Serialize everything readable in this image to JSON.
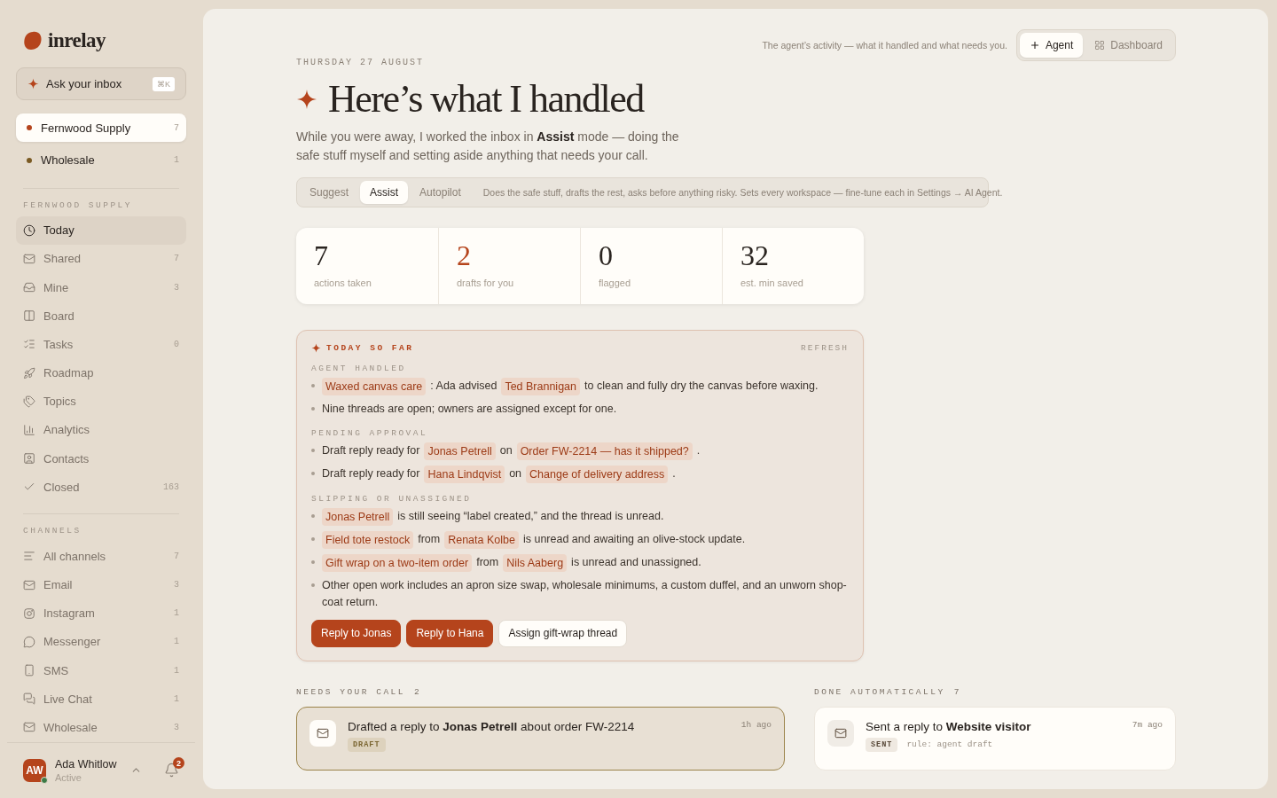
{
  "brand": {
    "name": "inrelay"
  },
  "ask": {
    "label": "Ask your inbox",
    "shortcut": "⌘K"
  },
  "workspaces": [
    {
      "name": "Fernwood Supply",
      "count": "7",
      "color": "#b5441c",
      "selected": true
    },
    {
      "name": "Wholesale",
      "count": "1",
      "color": "#7a5a22",
      "selected": false
    }
  ],
  "nav": {
    "title": "FERNWOOD SUPPLY",
    "items": [
      {
        "label": "Today",
        "selected": true
      },
      {
        "label": "Shared",
        "count": "7",
        "selected": false
      },
      {
        "label": "Mine",
        "count": "3",
        "selected": false
      },
      {
        "label": "Board",
        "selected": false
      },
      {
        "label": "Tasks",
        "count": "0",
        "selected": false
      },
      {
        "label": "Roadmap",
        "selected": false
      },
      {
        "label": "Topics",
        "selected": false
      },
      {
        "label": "Analytics",
        "selected": false
      },
      {
        "label": "Contacts",
        "selected": false
      },
      {
        "label": "Closed",
        "count": "163",
        "selected": false
      }
    ]
  },
  "channels": {
    "title": "CHANNELS",
    "items": [
      {
        "label": "All channels",
        "count": "7",
        "selected": false
      },
      {
        "label": "Email",
        "count": "3",
        "selected": false
      },
      {
        "label": "Instagram",
        "count": "1",
        "selected": false
      },
      {
        "label": "Messenger",
        "count": "1",
        "selected": false
      },
      {
        "label": "SMS",
        "count": "1",
        "selected": false
      },
      {
        "label": "Live Chat",
        "count": "1",
        "selected": false
      },
      {
        "label": "Wholesale",
        "count": "3",
        "selected": false
      }
    ]
  },
  "user": {
    "initials": "AW",
    "name": "Ada Whitlow",
    "status": "Active",
    "online": true,
    "notifications": "2"
  },
  "header": {
    "caption": "The agent’s activity — what it handled and what needs you.",
    "views": [
      {
        "label": "Agent",
        "selected": true
      },
      {
        "label": "Dashboard",
        "selected": false
      }
    ]
  },
  "date": "THURSDAY 27 AUGUST",
  "title": "Here’s what I handled",
  "intro": "While you were away, I worked the inbox in **Assist** mode — doing the safe stuff myself and setting aside anything that needs your call.",
  "modes": {
    "options": [
      {
        "label": "Suggest",
        "selected": false
      },
      {
        "label": "Assist",
        "selected": true
      },
      {
        "label": "Autopilot",
        "selected": false
      }
    ],
    "description": "Does the safe stuff, drafts the rest, asks before anything risky. Sets every workspace — fine-tune each in Settings → AI Agent."
  },
  "stats": [
    {
      "value": "7",
      "label": "actions taken",
      "highlight": false
    },
    {
      "value": "2",
      "label": "drafts for you",
      "highlight": true
    },
    {
      "value": "0",
      "label": "flagged",
      "highlight": false
    },
    {
      "value": "32",
      "label": "est. min saved",
      "highlight": false
    }
  ],
  "summary": {
    "title": "TODAY SO FAR",
    "refresh": "REFRESH",
    "sections": [
      {
        "heading": "AGENT HANDLED",
        "items": [
          [
            {
              "kind": "chip",
              "text": "Waxed canvas care"
            },
            {
              "kind": "text",
              "text": ": Ada advised"
            },
            {
              "kind": "chip",
              "text": "Ted Brannigan"
            },
            {
              "kind": "text",
              "text": "to clean and fully dry the canvas before waxing."
            }
          ],
          [
            {
              "kind": "text",
              "text": "Nine threads are open; owners are assigned except for one."
            }
          ]
        ]
      },
      {
        "heading": "PENDING APPROVAL",
        "items": [
          [
            {
              "kind": "text",
              "text": "Draft reply ready for"
            },
            {
              "kind": "chip",
              "text": "Jonas Petrell"
            },
            {
              "kind": "text",
              "text": "on"
            },
            {
              "kind": "chip",
              "text": "Order FW-2214 — has it shipped?"
            },
            {
              "kind": "text",
              "text": "."
            }
          ],
          [
            {
              "kind": "text",
              "text": "Draft reply ready for"
            },
            {
              "kind": "chip",
              "text": "Hana Lindqvist"
            },
            {
              "kind": "text",
              "text": "on"
            },
            {
              "kind": "chip",
              "text": "Change of delivery address"
            },
            {
              "kind": "text",
              "text": "."
            }
          ]
        ]
      },
      {
        "heading": "SLIPPING OR UNASSIGNED",
        "items": [
          [
            {
              "kind": "chip",
              "text": "Jonas Petrell"
            },
            {
              "kind": "text",
              "text": "is still seeing “label created,” and the thread is unread."
            }
          ],
          [
            {
              "kind": "chip",
              "text": "Field tote restock"
            },
            {
              "kind": "text",
              "text": "from"
            },
            {
              "kind": "chip",
              "text": "Renata Kolbe"
            },
            {
              "kind": "text",
              "text": "is unread and awaiting an olive-stock update."
            }
          ],
          [
            {
              "kind": "chip",
              "text": "Gift wrap on a two-item order"
            },
            {
              "kind": "text",
              "text": "from"
            },
            {
              "kind": "chip",
              "text": "Nils Aaberg"
            },
            {
              "kind": "text",
              "text": "is unread and unassigned."
            }
          ],
          [
            {
              "kind": "text",
              "text": "Other open work includes an apron size swap, wholesale minimums, a custom duffel, and an unworn shop-coat return."
            }
          ]
        ]
      }
    ],
    "actions": [
      {
        "label": "Reply to Jonas",
        "kind": "primary"
      },
      {
        "label": "Reply to Hana",
        "kind": "primary"
      },
      {
        "label": "Assign gift-wrap thread",
        "kind": "secondary"
      }
    ]
  },
  "needs_call": {
    "title": "NEEDS YOUR CALL",
    "count": "2",
    "card": {
      "text": "Drafted a reply to **Jonas Petrell** about order FW-2214",
      "time": "1h ago",
      "tag": "DRAFT"
    }
  },
  "done": {
    "title": "DONE AUTOMATICALLY",
    "count": "7",
    "card": {
      "text": "Sent a reply to **Website visitor**",
      "time": "7m ago",
      "tag": "SENT",
      "rule": "rule: agent draft"
    }
  }
}
